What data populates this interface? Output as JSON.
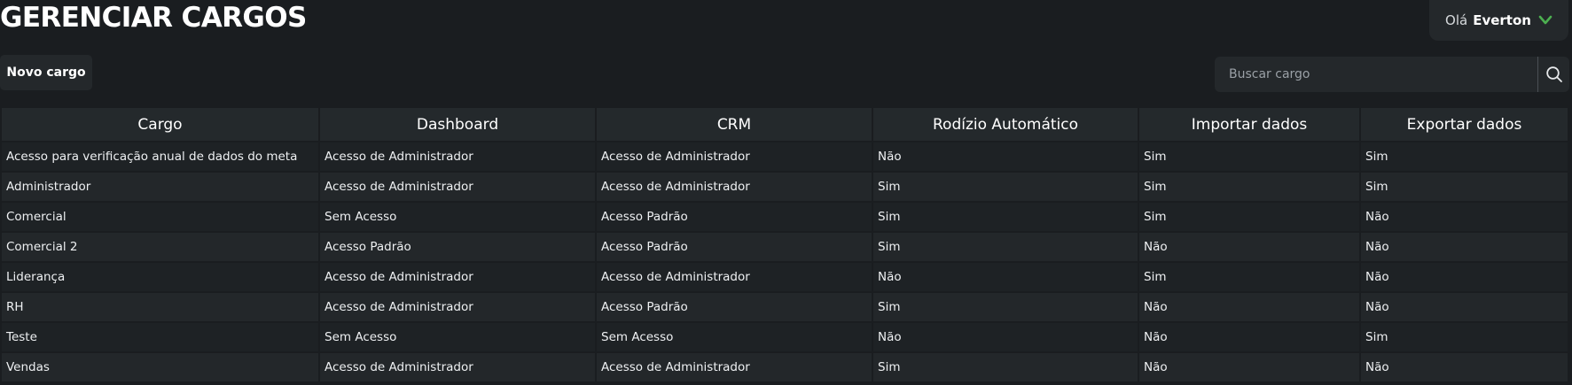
{
  "header": {
    "title": "GERENCIAR CARGOS",
    "greeting": "Olá",
    "user_name": "Everton",
    "chevron_icon": "chevron-down-icon",
    "accent_color": "#4caf50"
  },
  "toolbar": {
    "new_button_label": "Novo cargo",
    "search_placeholder": "Buscar cargo",
    "search_value": "",
    "search_icon": "search-icon"
  },
  "table": {
    "columns": [
      "Cargo",
      "Dashboard",
      "CRM",
      "Rodízio Automático",
      "Importar dados",
      "Exportar dados"
    ],
    "rows": [
      [
        "Acesso para verificação anual de dados do meta",
        "Acesso de Administrador",
        "Acesso de Administrador",
        "Não",
        "Sim",
        "Sim"
      ],
      [
        "Administrador",
        "Acesso de Administrador",
        "Acesso de Administrador",
        "Sim",
        "Sim",
        "Sim"
      ],
      [
        "Comercial",
        "Sem Acesso",
        "Acesso Padrão",
        "Sim",
        "Sim",
        "Não"
      ],
      [
        "Comercial 2",
        "Acesso Padrão",
        "Acesso Padrão",
        "Sim",
        "Não",
        "Não"
      ],
      [
        "Liderança",
        "Acesso de Administrador",
        "Acesso de Administrador",
        "Não",
        "Sim",
        "Não"
      ],
      [
        "RH",
        "Acesso de Administrador",
        "Acesso Padrão",
        "Sim",
        "Não",
        "Não"
      ],
      [
        "Teste",
        "Sem Acesso",
        "Sem Acesso",
        "Não",
        "Não",
        "Sim"
      ],
      [
        "Vendas",
        "Acesso de Administrador",
        "Acesso de Administrador",
        "Sim",
        "Não",
        "Não"
      ]
    ]
  }
}
